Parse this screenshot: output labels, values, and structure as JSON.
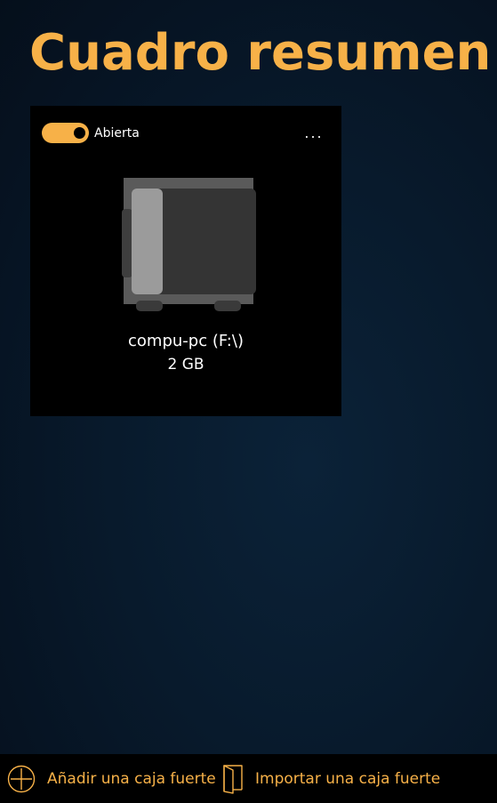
{
  "page": {
    "title": "Cuadro resumen"
  },
  "vault": {
    "toggle_state": "on",
    "toggle_label": "Abierta",
    "more_label": "...",
    "icon": "safe-icon",
    "name": "compu-pc (F:\\)",
    "size": "2 GB"
  },
  "command_bar": {
    "add_icon": "add-circle-icon",
    "add_label": "Añadir una caja fuerte",
    "import_icon": "import-door-icon",
    "import_label": "Importar una caja fuerte"
  },
  "colors": {
    "accent": "#f7b148",
    "card_background": "#000000",
    "page_background": "#081a2c"
  }
}
